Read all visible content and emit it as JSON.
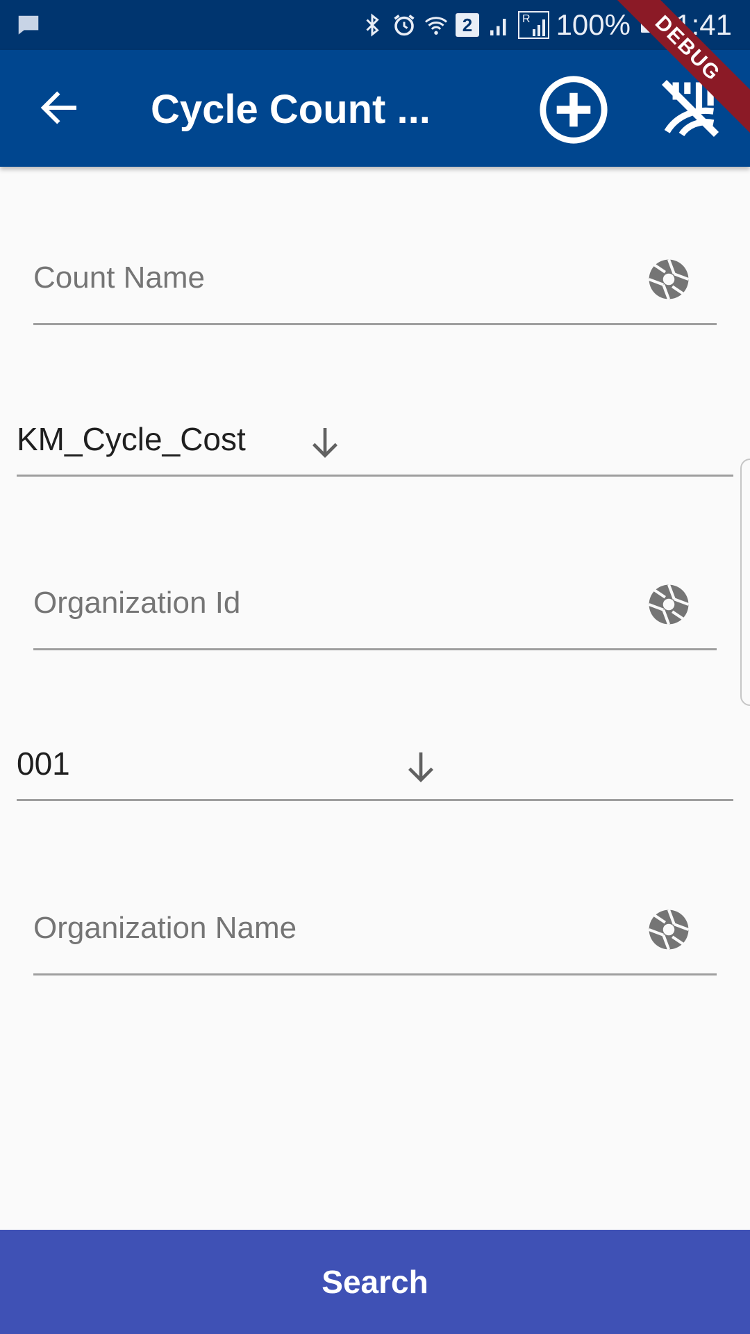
{
  "status_bar": {
    "battery": "100%",
    "time": "11:41",
    "sim_badge": "2",
    "roaming_label": "R"
  },
  "app_bar": {
    "title": "Cycle Count ...",
    "debug_label": "DEBUG"
  },
  "form": {
    "count_name": {
      "placeholder": "Count Name",
      "value": ""
    },
    "cycle_dropdown": {
      "selected": "KM_Cycle_Cost"
    },
    "organization_id": {
      "placeholder": "Organization Id",
      "value": ""
    },
    "org_id_dropdown": {
      "selected": "001"
    },
    "organization_name": {
      "placeholder": "Organization Name",
      "value": ""
    }
  },
  "actions": {
    "search_label": "Search"
  },
  "colors": {
    "app_bar": "#00468f",
    "status_bar": "#00356f",
    "search_button": "#3f51b5",
    "debug_banner": "#8b1a26"
  },
  "icons": {
    "back": "arrow-left-icon",
    "add": "plus-circle-icon",
    "scan": "barcode-scan-off-icon",
    "camera": "camera-shutter-icon",
    "dropdown": "arrow-down-icon"
  }
}
